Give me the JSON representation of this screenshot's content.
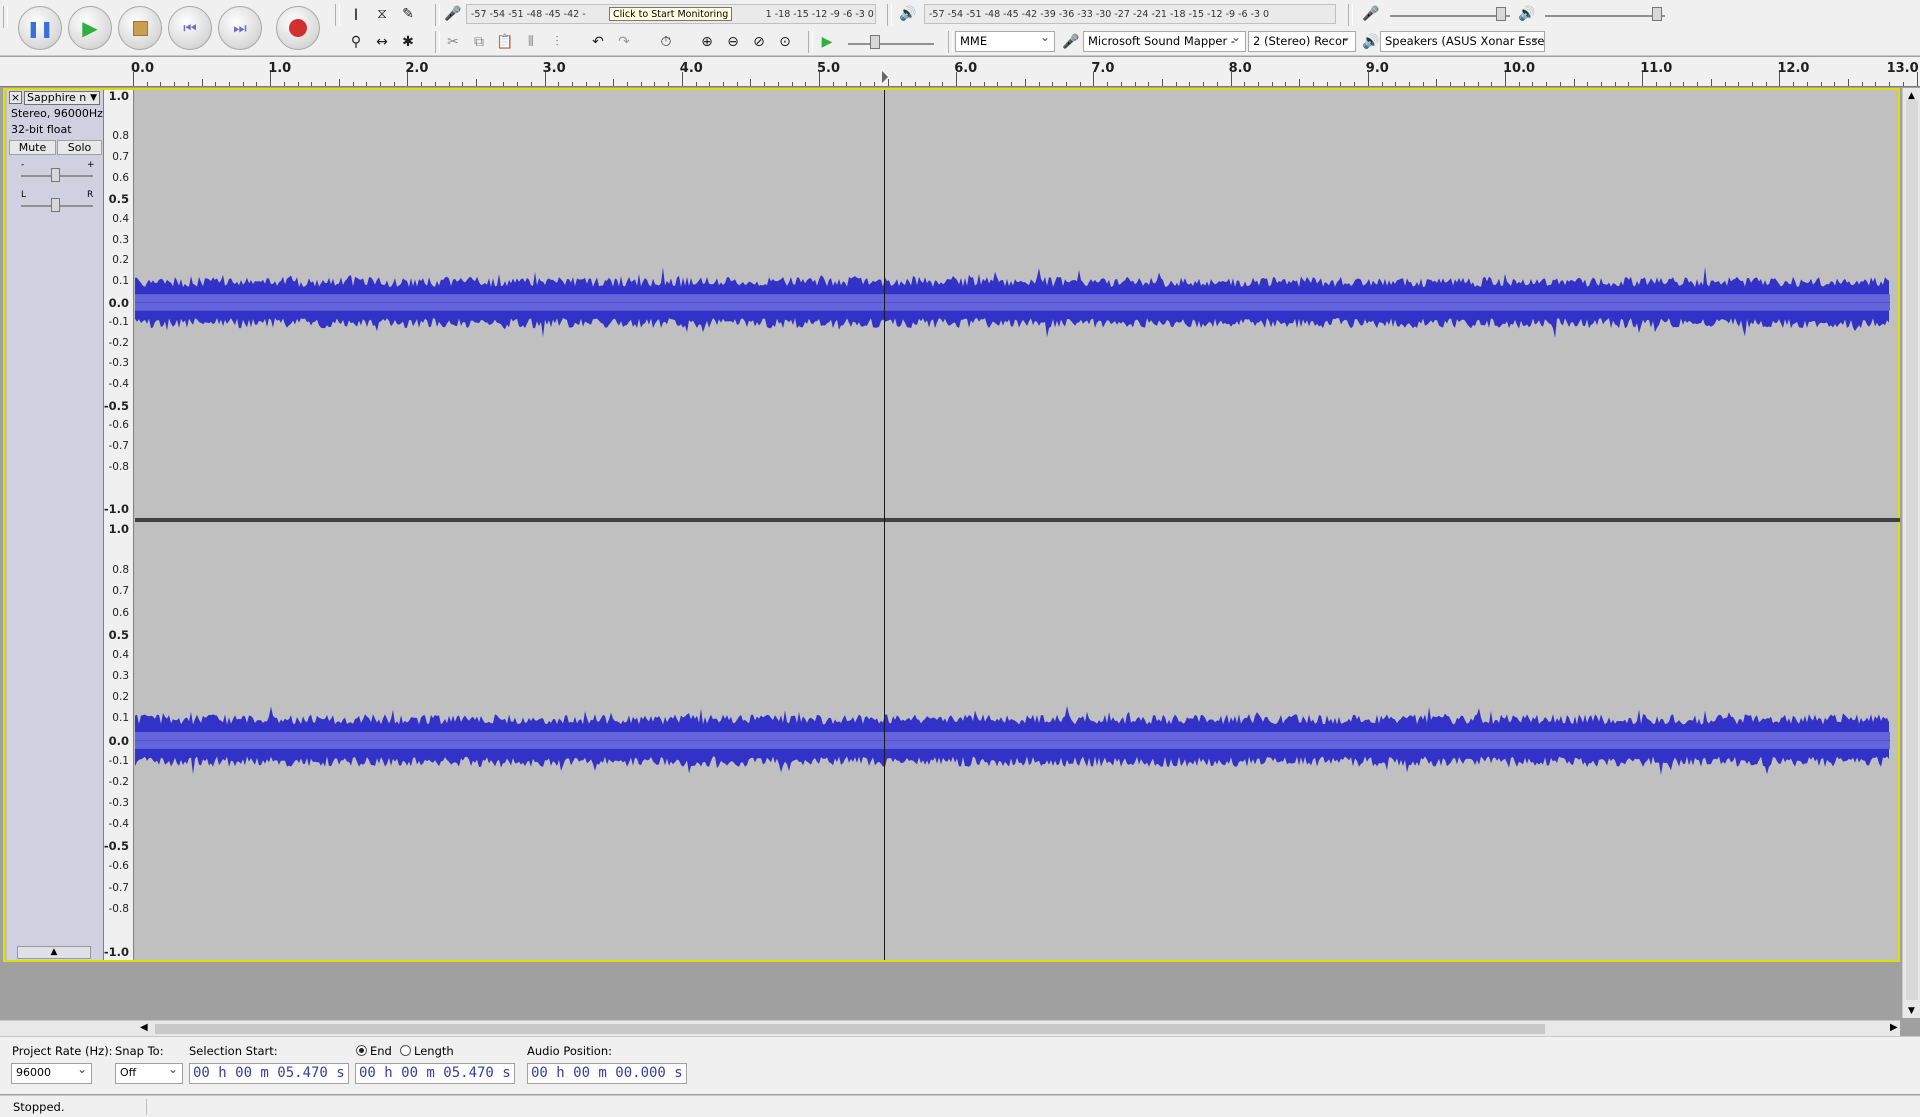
{
  "transport": {
    "pause": "Pause",
    "play": "Play",
    "stop": "Stop",
    "skip_start": "Skip to Start",
    "skip_end": "Skip to End",
    "record": "Record"
  },
  "meters": {
    "record_scale": "-57 -54 -51 -48 -45 -42 -",
    "record_scale_right": "1 -18 -15 -12 -9 -6 -3 0",
    "monitor_tip": "Click to Start Monitoring",
    "playback_scale": "-57 -54 -51 -48 -45 -42 -39 -36 -33 -30 -27 -24 -21 -18 -15 -12 -9 -6 -3 0"
  },
  "device": {
    "host": "MME",
    "input": "Microsoft Sound Mapper -",
    "channels": "2 (Stereo) Recor",
    "output": "Speakers (ASUS Xonar Esse"
  },
  "ruler": {
    "labels": [
      "0.0",
      "1.0",
      "2.0",
      "3.0",
      "4.0",
      "5.0",
      "6.0",
      "7.0",
      "8.0",
      "9.0",
      "10.0",
      "11.0",
      "12.0",
      "13.0"
    ]
  },
  "track": {
    "name": "Sapphire n",
    "format_line1": "Stereo, 96000Hz",
    "format_line2": "32-bit float",
    "mute": "Mute",
    "solo": "Solo",
    "gain_minus": "-",
    "gain_plus": "+",
    "pan_left": "L",
    "pan_right": "R"
  },
  "vscale": [
    "1.0",
    "0.8",
    "0.7",
    "0.6",
    "0.5",
    "0.4",
    "0.3",
    "0.2",
    "0.1",
    "0.0",
    "-0.1",
    "-0.2",
    "-0.3",
    "-0.4",
    "-0.5",
    "-0.6",
    "-0.7",
    "-0.8",
    "-1.0"
  ],
  "colors": {
    "wave_outer": "#3232c8",
    "wave_rms": "#6464dc",
    "track_bg": "#c0c0c0",
    "select_border": "#e0e000"
  },
  "selection": {
    "rate_label": "Project Rate (Hz):",
    "rate_value": "96000",
    "snap_label": "Snap To:",
    "snap_value": "Off",
    "start_label": "Selection Start:",
    "start_value": "00 h 00 m 05.470 s",
    "end_label": "End",
    "length_label": "Length",
    "end_value": "00 h 00 m 05.470 s",
    "audio_pos_label": "Audio Position:",
    "audio_pos_value": "00 h 00 m 00.000 s"
  },
  "status": {
    "text": "Stopped."
  }
}
